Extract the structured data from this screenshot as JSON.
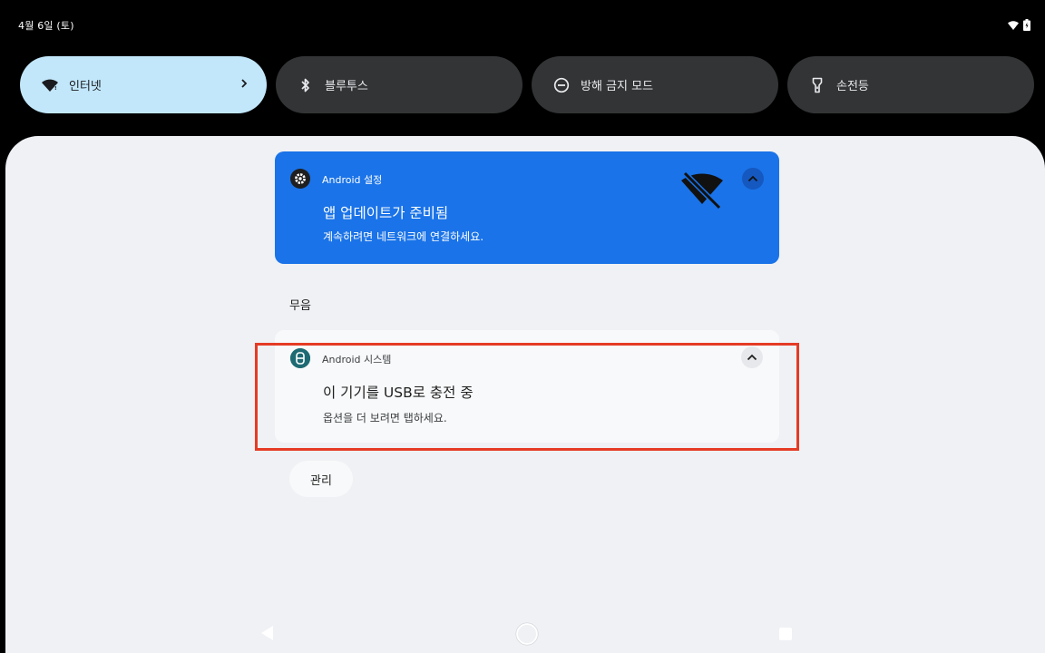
{
  "status_bar": {
    "date": "4월 6일 (토)",
    "icons": [
      "wifi-icon",
      "battery-icon"
    ]
  },
  "quick_tiles": [
    {
      "label": "인터넷",
      "icon": "wifi-icon",
      "active": true,
      "has_chevron": true
    },
    {
      "label": "블루투스",
      "icon": "bluetooth-icon",
      "active": false
    },
    {
      "label": "방해 금지 모드",
      "icon": "do-not-disturb-icon",
      "active": false
    },
    {
      "label": "손전등",
      "icon": "flashlight-icon",
      "active": false
    }
  ],
  "notifications": {
    "update": {
      "app_name": "Android 설정",
      "icon": "gear-icon",
      "title": "앱 업데이트가 준비됨",
      "text": "계속하려면 네트워크에 연결하세요.",
      "large_icon": "wifi-off-icon",
      "color": "#1a73e8"
    },
    "silent_section_label": "무음",
    "usb": {
      "app_name": "Android 시스템",
      "icon": "usb-icon",
      "title": "이 기기를 USB로 충전 중",
      "text": "옵션을 더 보려면 탭하세요.",
      "icon_color": "#1d6a73"
    }
  },
  "manage_button": "관리",
  "nav_bar": [
    "back-icon",
    "home-icon",
    "recents-icon"
  ],
  "highlight_color": "#e53b25"
}
